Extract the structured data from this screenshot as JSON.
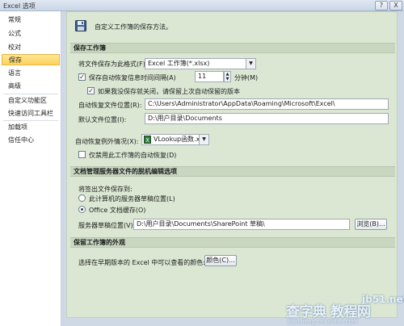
{
  "window": {
    "title": "Excel 选项",
    "help_button": "?",
    "close_button": "X"
  },
  "sidebar": {
    "items": [
      {
        "label": "常规"
      },
      {
        "label": "公式"
      },
      {
        "label": "校对"
      },
      {
        "label": "保存",
        "active": true
      },
      {
        "label": "语言"
      },
      {
        "label": "高级"
      },
      {
        "label": "自定义功能区"
      },
      {
        "label": "快速访问工具栏"
      },
      {
        "label": "加载项"
      },
      {
        "label": "信任中心"
      }
    ]
  },
  "header": {
    "text": "自定义工作簿的保存方法。",
    "icon": "floppy-disk-icon"
  },
  "save_workbooks": {
    "heading": "保存工作簿",
    "format_label": "将文件保存为此格式(F):",
    "format_value": "Excel 工作簿(*.xlsx)",
    "autorecover_checkbox_label": "保存自动恢复信息时间间隔(A)",
    "autorecover_checked": true,
    "autorecover_minutes": "11",
    "minutes_unit": "分钟(M)",
    "keep_last_label": "如果我没保存就关闭，请保留上次自动保留的版本",
    "keep_last_checked": true,
    "autorecover_location_label": "自动恢复文件位置(R):",
    "autorecover_location_value": "C:\\Users\\Administrator\\AppData\\Roaming\\Microsoft\\Excel\\",
    "default_location_label": "默认文件位置(I):",
    "default_location_value": "D:\\用户目录\\Documents"
  },
  "autorecover_exceptions": {
    "label": "自动恢复例外情况(X):",
    "workbook_value": "VLookup函数.x...",
    "disable_label": "仅禁用此工作簿的自动恢复(D)",
    "disable_checked": false
  },
  "offline_editing": {
    "heading": "文档管理服务器文件的脱机编辑选项",
    "save_to_label": "将签出文件保存到:",
    "option_server_label": "此计算机的服务器草稿位置(L)",
    "option_cache_label": "Office 文档缓存(O)",
    "selected_option": "Office 文档缓存(O)",
    "drafts_location_label": "服务器草稿位置(V):",
    "drafts_location_value": "D:\\用户目录\\Documents\\SharePoint 草稿\\",
    "browse_button": "浏览(B)..."
  },
  "appearance": {
    "heading": "保留工作簿的外观",
    "colors_label": "选择在早期版本的 Excel 中可以查看的颜色:",
    "colors_button": "颜色(C)..."
  },
  "watermark": {
    "line1": "jb51.net",
    "line2": "查字典 教程网",
    "line3": "jiaocheng.chazidian.com"
  },
  "colors": {
    "active_nav": "#ffd35a",
    "panel_bg": "#dbe7d3",
    "section_bg": "#c9d7c1"
  }
}
